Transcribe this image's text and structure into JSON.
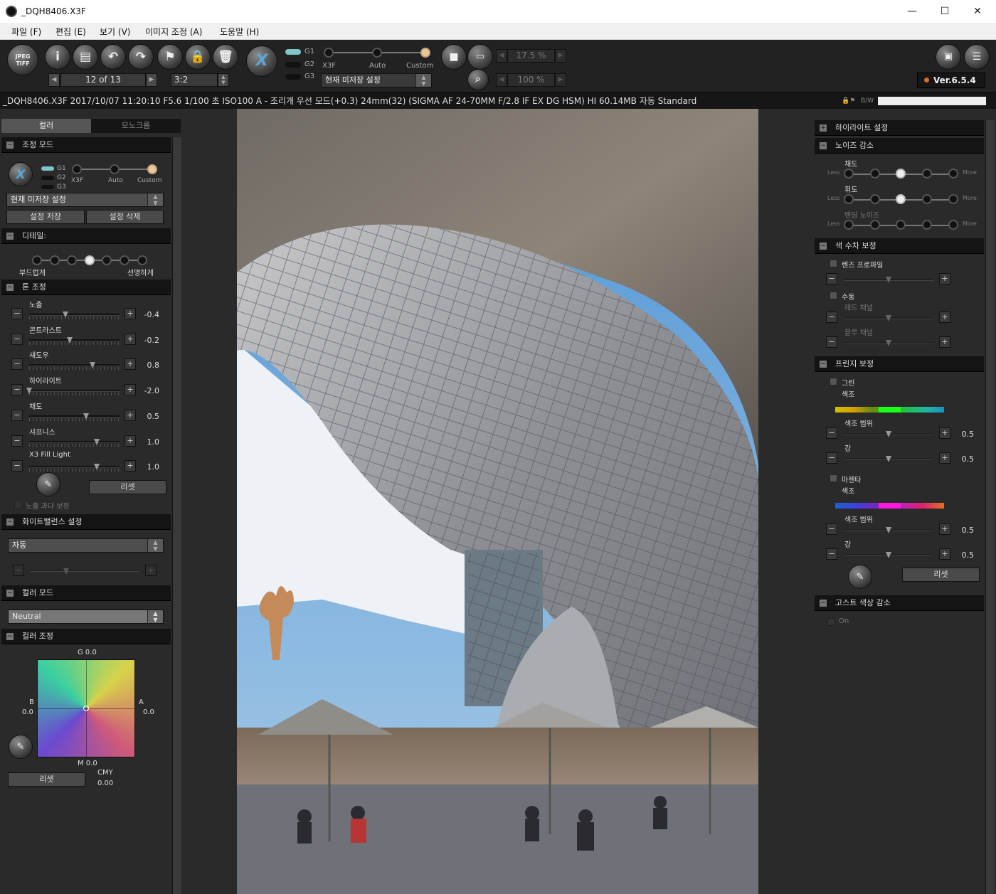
{
  "window": {
    "title": "_DQH8406.X3F",
    "min": "—",
    "max": "☐",
    "close": "✕"
  },
  "menu": [
    "파일 (F)",
    "편집 (E)",
    "보기 (V)",
    "이미지 조정 (A)",
    "도움말 (H)"
  ],
  "toolbar": {
    "jpeg_tiff_top": "JPEG",
    "jpeg_tiff_bottom": "TIFF",
    "counter": "12 of 13",
    "ratio": "3:2",
    "mode_labels": [
      "G1",
      "G2",
      "G3"
    ],
    "mode_options": [
      "X3F",
      "Auto",
      "Custom"
    ],
    "preset": "현재 미저장 설정",
    "zoom_fit": "17.5 %",
    "zoom_actual": "100 %",
    "version": "Ver.6.5.4"
  },
  "info": {
    "text": "_DQH8406.X3F 2017/10/07 11:20:10 F5.6 1/100 초 ISO100 A - 조리개 우선 모드(+0.3) 24mm(32) (SIGMA AF 24-70MM F/2.8 IF EX DG HSM) HI 60.14MB 자동 Standard",
    "bw": "B/W"
  },
  "left": {
    "tabs": [
      "컬러",
      "모노크롬"
    ],
    "adjust_mode": {
      "title": "조정 모드",
      "g": [
        "G1",
        "G2",
        "G3"
      ],
      "options": [
        "X3F",
        "Auto",
        "Custom"
      ],
      "preset": "현재 미저장 설정",
      "save": "설정 저장",
      "delete": "설정 삭제"
    },
    "detail": {
      "title": "디테일:",
      "soft": "부드럽게",
      "sharp": "선명하게",
      "level": 4,
      "levels": 7
    },
    "tone": {
      "title": "톤 조정",
      "sliders": [
        {
          "label": "노출",
          "value": "-0.4",
          "pos": 0.4
        },
        {
          "label": "콘트라스트",
          "value": "-0.2",
          "pos": 0.45
        },
        {
          "label": "섀도우",
          "value": "0.8",
          "pos": 0.7
        },
        {
          "label": "하이라이트",
          "value": "-2.0",
          "pos": 0.0
        },
        {
          "label": "채도",
          "value": "0.5",
          "pos": 0.63
        },
        {
          "label": "샤프니스",
          "value": "1.0",
          "pos": 0.75
        },
        {
          "label": "X3 Fill Light",
          "value": "1.0",
          "pos": 0.75
        }
      ],
      "reset": "리셋",
      "overexposure": "노출 과다 보정"
    },
    "white_balance": {
      "title": "화이트밸런스 설정",
      "value": "자동"
    },
    "color_mode": {
      "title": "컬러 모드",
      "value": "Neutral"
    },
    "color_adjust": {
      "title": "컬러 조정",
      "g": "G 0.0",
      "b_label": "B",
      "b": "0.0",
      "a_label": "A",
      "a": "0.0",
      "m": "M 0.0",
      "cmy_label": "CMY",
      "cmy": "0.00",
      "reset": "리셋"
    }
  },
  "right": {
    "highlight": {
      "title": "하이라이트 설정"
    },
    "noise": {
      "title": "노이즈 감소",
      "rows": [
        {
          "label": "채도",
          "less": "Less",
          "more": "More",
          "level": 3
        },
        {
          "label": "휘도",
          "less": "Less",
          "more": "More",
          "level": 3
        },
        {
          "label": "밴딩 노이즈",
          "less": "Less",
          "more": "More",
          "level": 0
        }
      ]
    },
    "aberration": {
      "title": "색 수차 보정",
      "lens_profile": "렌즈 프로파일",
      "manual": "수동",
      "red": "레드 채널",
      "blue": "블루 채널"
    },
    "fringe": {
      "title": "프린지 보정",
      "green": "그린",
      "magenta": "마젠타",
      "hue": "색조",
      "hue_range": "색조 범위",
      "amount": "강",
      "values": [
        "0.5",
        "0.5",
        "0.5",
        "0.5"
      ],
      "reset": "리셋"
    },
    "ghost": {
      "title": "고스트 색상 감소",
      "on": "On"
    }
  },
  "colors": {
    "accent_orange": "#e36b1d",
    "toolbar_bg": "#222222",
    "panel_bg": "#2a2a2a",
    "mode_selected": "#7fc5c9"
  }
}
